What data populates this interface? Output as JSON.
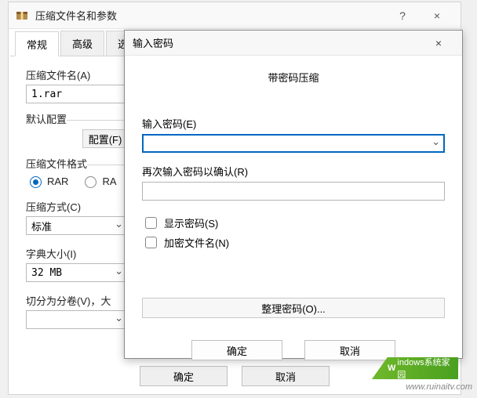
{
  "main": {
    "title": "压缩文件名和参数",
    "help_glyph": "?",
    "close_glyph": "×"
  },
  "tabs": [
    "常规",
    "高级",
    "选项"
  ],
  "fields": {
    "filename_label": "压缩文件名(A)",
    "filename_value": "1.rar",
    "default_config_label": "默认配置",
    "config_button": "配置(F)",
    "format_label": "压缩文件格式",
    "format_rar": "RAR",
    "format_rar_alt": "RA",
    "method_label": "压缩方式(C)",
    "method_value": "标准",
    "dict_label": "字典大小(I)",
    "dict_value": "32 MB",
    "split_label": "切分为分卷(V)，大"
  },
  "buttons": {
    "ok": "确定",
    "cancel": "取消"
  },
  "pw": {
    "title": "输入密码",
    "heading": "带密码压缩",
    "enter_label": "输入密码(E)",
    "reenter_label": "再次输入密码以确认(R)",
    "show": "显示密码(S)",
    "encrypt_names": "加密文件名(N)",
    "organize": "整理密码(O)...",
    "ok": "确定",
    "cancel": "取消",
    "close_glyph": "×"
  },
  "watermark": {
    "logo": "indows系统家园",
    "url": "www.ruinaitv.com"
  }
}
